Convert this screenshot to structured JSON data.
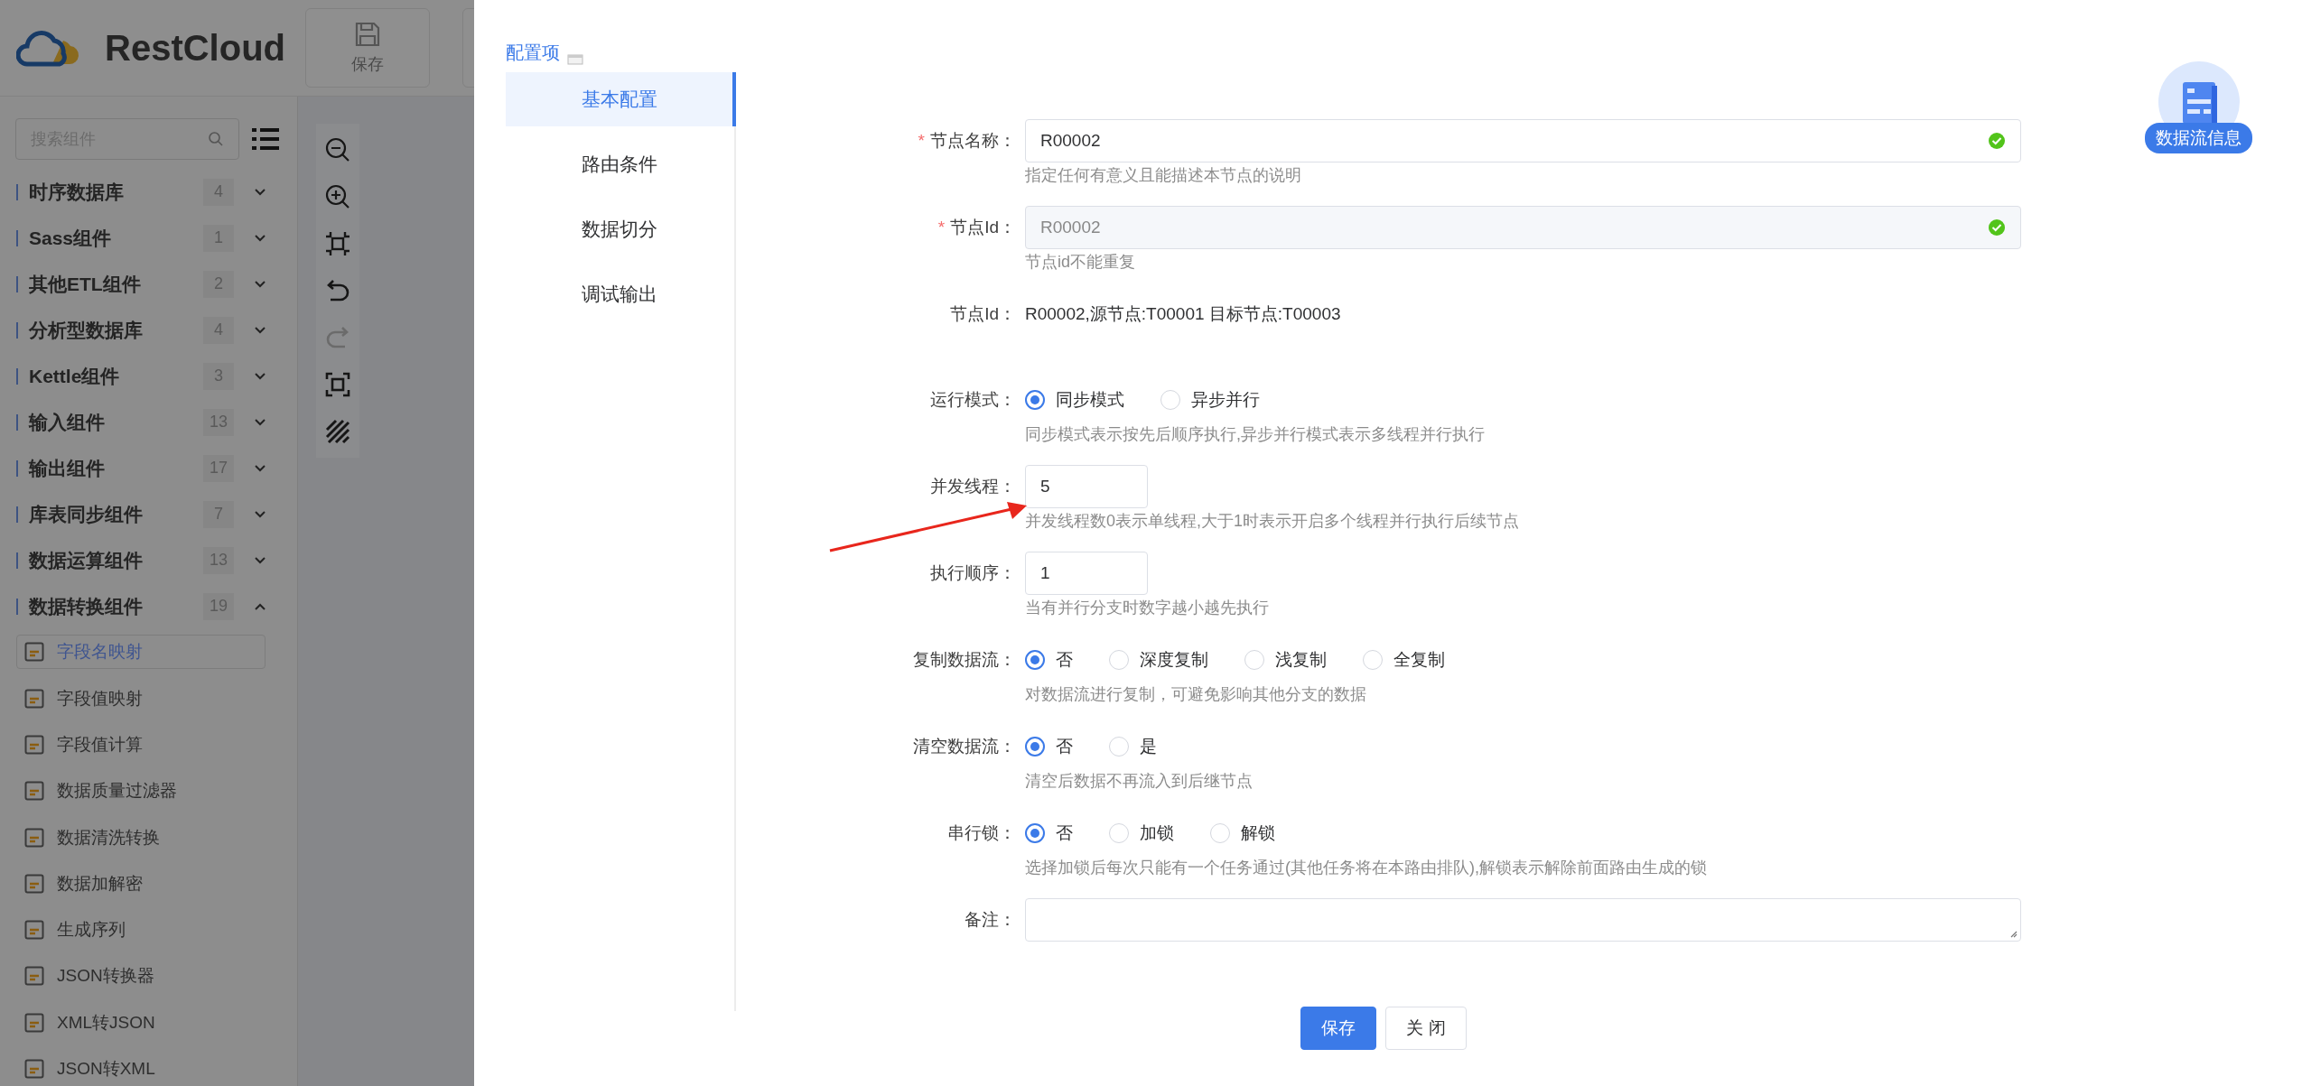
{
  "app": {
    "logo_text": "RestCloud",
    "toolbar": [
      {
        "label": "保存"
      }
    ]
  },
  "sidebar": {
    "search": {
      "placeholder": "搜索组件"
    },
    "categories": [
      {
        "name": "时序数据库",
        "count": "4",
        "expanded": false
      },
      {
        "name": "Sass组件",
        "count": "1",
        "expanded": false
      },
      {
        "name": "其他ETL组件",
        "count": "2",
        "expanded": false
      },
      {
        "name": "分析型数据库",
        "count": "4",
        "expanded": false
      },
      {
        "name": "Kettle组件",
        "count": "3",
        "expanded": false
      },
      {
        "name": "输入组件",
        "count": "13",
        "expanded": false
      },
      {
        "name": "输出组件",
        "count": "17",
        "expanded": false
      },
      {
        "name": "库表同步组件",
        "count": "7",
        "expanded": false
      },
      {
        "name": "数据运算组件",
        "count": "13",
        "expanded": false
      },
      {
        "name": "数据转换组件",
        "count": "19",
        "expanded": true,
        "children": [
          {
            "label": "字段名映射",
            "selected": true
          },
          {
            "label": "字段值映射",
            "selected": false
          },
          {
            "label": "字段值计算",
            "selected": false
          },
          {
            "label": "数据质量过滤器",
            "selected": false
          },
          {
            "label": "数据清洗转换",
            "selected": false
          },
          {
            "label": "数据加解密",
            "selected": false
          },
          {
            "label": "生成序列",
            "selected": false
          },
          {
            "label": "JSON转换器",
            "selected": false
          },
          {
            "label": "XML转JSON",
            "selected": false
          },
          {
            "label": "JSON转XML",
            "selected": false
          }
        ]
      }
    ]
  },
  "canvas_tools": [
    {
      "kind": "zoom-out",
      "disabled": false
    },
    {
      "kind": "zoom-in",
      "disabled": false
    },
    {
      "kind": "fit",
      "disabled": false
    },
    {
      "kind": "undo",
      "disabled": false
    },
    {
      "kind": "redo",
      "disabled": true
    },
    {
      "kind": "fullscreen",
      "disabled": false
    },
    {
      "kind": "grid",
      "disabled": false
    }
  ],
  "dialog": {
    "nav_title": "配置项",
    "nav": [
      {
        "label": "基本配置",
        "selected": true
      },
      {
        "label": "路由条件",
        "selected": false
      },
      {
        "label": "数据切分",
        "selected": false
      },
      {
        "label": "调试输出",
        "selected": false
      }
    ],
    "info_badge": "数据流信息",
    "fields": [
      {
        "kind": "input",
        "label": "节点名称：",
        "required_mark": "*",
        "value": "R00002",
        "disabled": false,
        "valid": true,
        "help": "指定任何有意义且能描述本节点的说明"
      },
      {
        "kind": "input",
        "label": "节点Id：",
        "required_mark": "*",
        "value": "R00002",
        "disabled": true,
        "valid": true,
        "help": "节点id不能重复"
      },
      {
        "kind": "text",
        "label": "节点Id：",
        "value": "R00002,源节点:T00001 目标节点:T00003"
      },
      {
        "kind": "radio",
        "label": "运行模式：",
        "options": [
          {
            "label": "同步模式",
            "selected": true
          },
          {
            "label": "异步并行",
            "selected": false
          }
        ],
        "help": "同步模式表示按先后顺序执行,异步并行模式表示多线程并行执行"
      },
      {
        "kind": "number",
        "label": "并发线程：",
        "value": "5",
        "help": "并发线程数0表示单线程,大于1时表示开启多个线程并行执行后续节点"
      },
      {
        "kind": "number",
        "label": "执行顺序：",
        "value": "1",
        "help": "当有并行分支时数字越小越先执行"
      },
      {
        "kind": "radio",
        "label": "复制数据流：",
        "options": [
          {
            "label": "否",
            "selected": true
          },
          {
            "label": "深度复制",
            "selected": false
          },
          {
            "label": "浅复制",
            "selected": false
          },
          {
            "label": "全复制",
            "selected": false
          }
        ],
        "help": "对数据流进行复制，可避免影响其他分支的数据"
      },
      {
        "kind": "radio",
        "label": "清空数据流：",
        "options": [
          {
            "label": "否",
            "selected": true
          },
          {
            "label": "是",
            "selected": false
          }
        ],
        "help": "清空后数据不再流入到后继节点"
      },
      {
        "kind": "radio",
        "label": "串行锁：",
        "options": [
          {
            "label": "否",
            "selected": true
          },
          {
            "label": "加锁",
            "selected": false
          },
          {
            "label": "解锁",
            "selected": false
          }
        ],
        "help": "选择加锁后每次只能有一个任务通过(其他任务将在本路由排队),解锁表示解除前面路由生成的锁"
      },
      {
        "kind": "textarea",
        "label": "备注："
      }
    ],
    "buttons": [
      {
        "label": "保存",
        "kind": "primary"
      },
      {
        "label": "关 闭",
        "kind": "default"
      }
    ]
  }
}
